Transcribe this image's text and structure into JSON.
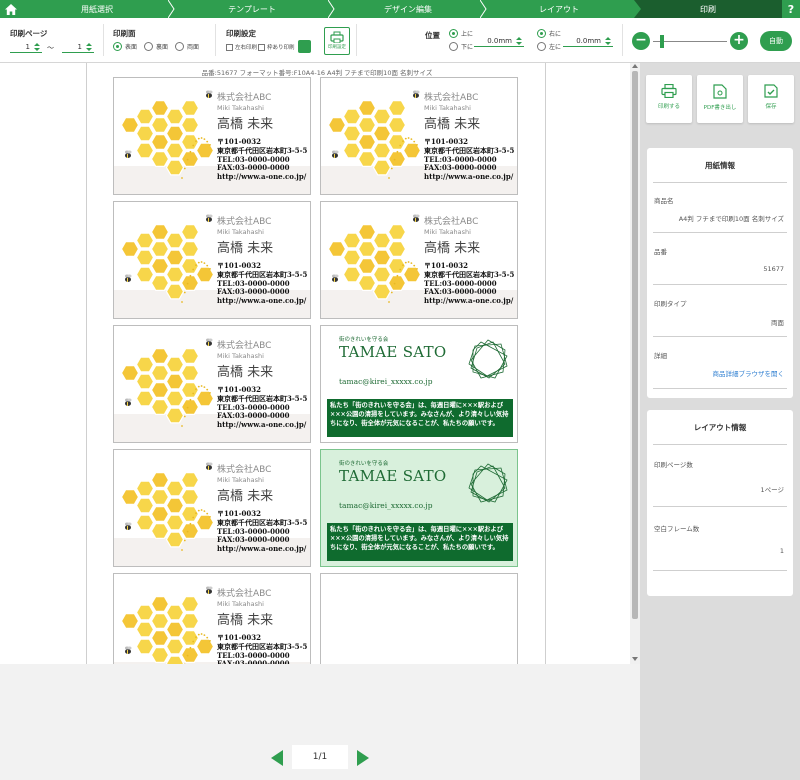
{
  "nav": {
    "steps": [
      "用紙選択",
      "テンプレート",
      "デザイン編集",
      "レイアウト",
      "印刷"
    ],
    "active_step": 4,
    "help": "?"
  },
  "toolbar": {
    "print_page": {
      "label": "印刷ページ",
      "from": "1",
      "to": "1",
      "tilde": "～"
    },
    "print_side": {
      "label": "印刷面",
      "options": [
        "表面",
        "裏面",
        "両面"
      ],
      "selected": 0
    },
    "print_settings": {
      "label": "印刷設定",
      "opt1": "左右印刷",
      "opt2": "枠あり印刷",
      "icon_label": "印刷設定"
    },
    "position": {
      "label": "位置",
      "vertical": [
        "上に",
        "下に"
      ],
      "vertical_selected": 0,
      "vertical_value": "0.0mm",
      "horizontal": [
        "右に",
        "左に"
      ],
      "horizontal_selected": 0,
      "horizontal_value": "0.0mm"
    },
    "zoom": {
      "minus": "−",
      "plus": "+",
      "level": 0.1,
      "auto": "自動"
    }
  },
  "sheet": {
    "info": "品番:51677 フォーマット番号:F10A4-16 A4判 フチまで印刷10面 名刺サイズ"
  },
  "card_honey": {
    "company": "株式会社ABC",
    "romaji": "Miki Takahashi",
    "name": "高橋 未来",
    "address": [
      "〒101-0032",
      "東京都千代田区岩本町3-5-5",
      "TEL:03-0000-0000",
      "FAX:03-0000-0000",
      "http://www.a-one.co.jp/"
    ]
  },
  "card_tamae": {
    "small": "街のきれいを守る会",
    "name": "TAMAE SATO",
    "email": "tamac@kirei_xxxxx.co.jp",
    "message": "私たち「街のきれいを守る会」は、毎週日曜に×××駅および×××公園の清掃をしています。みなさんが、より清々しい気持ちになり、街全体が元気になることが、私たちの願いです。"
  },
  "pager": {
    "value": "1/1"
  },
  "actions": {
    "print": "印刷する",
    "pdf": "PDF書き出し",
    "save": "保存"
  },
  "paper_info": {
    "title": "用紙情報",
    "product_name_label": "商品名",
    "product_name": "A4判 フチまで印刷10面 名刺サイズ",
    "product_no_label": "品番",
    "product_no": "51677",
    "print_type_label": "印刷タイプ",
    "print_type": "両面",
    "detail_label": "詳細",
    "detail_link": "商品詳細ブラウザを開く"
  },
  "layout_info": {
    "title": "レイアウト情報",
    "pages_label": "印刷ページ数",
    "pages": "1ページ",
    "empty_label": "空白フレーム数",
    "empty": "1"
  },
  "colors": {
    "accent": "#2f9e4f",
    "dark": "#1b5e2e",
    "honey": "#f7d64a",
    "card_green": "#0f6b2e"
  }
}
